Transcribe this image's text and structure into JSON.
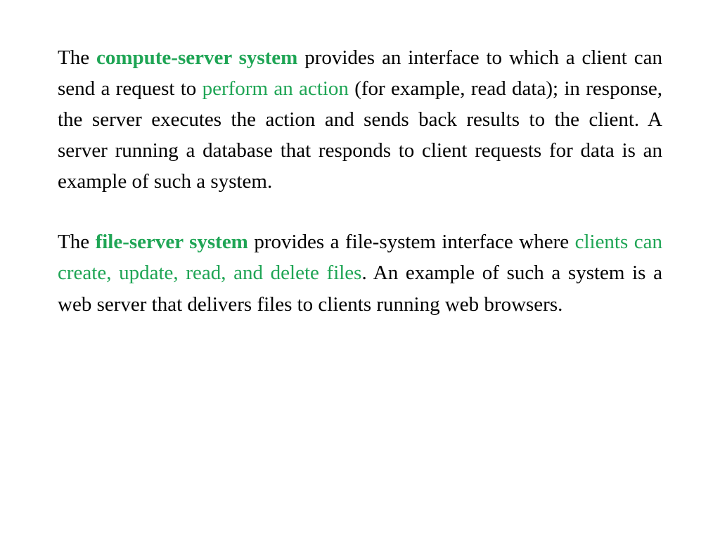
{
  "paragraph1": {
    "seg1": "The ",
    "seg2": "compute-server system",
    "seg3": " provides an interface to which a client can send a request to ",
    "seg4": "perform an action",
    "seg5": " (for example, read data); in response, the server executes the action and sends back results to the client. A server running a database that responds to client requests for data is an example of such a system."
  },
  "paragraph2": {
    "seg1": " The ",
    "seg2": "file-server system",
    "seg3": " provides a file-system interface where ",
    "seg4": "clients can create, update, read, and delete files",
    "seg5": ". An example of such a system is a web server that delivers files to clients running web browsers."
  },
  "colors": {
    "highlight": "#1fa555",
    "text": "#000000"
  }
}
